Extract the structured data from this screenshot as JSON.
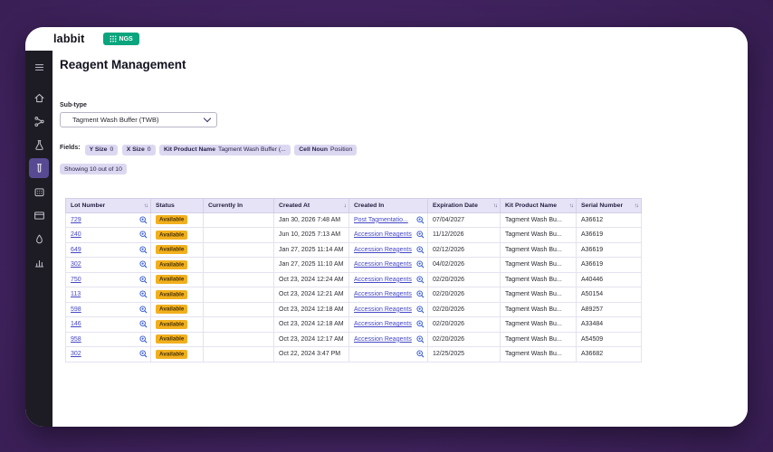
{
  "colors": {
    "teal": "#0aa57d",
    "chip_bg": "#dcd8f1",
    "link": "#4446c6",
    "status_bg": "#f2b01e",
    "status_text": "#4a3300",
    "header_bg": "#e7e3f7",
    "sidebar_bg": "#1d1c24",
    "sidebar_active": "#584a92",
    "zoom_icon": "#2f55d4"
  },
  "app": {
    "logo": "labbit",
    "badge_label": "NGS"
  },
  "sidebar": {
    "items": [
      {
        "name": "menu"
      },
      {
        "name": "home"
      },
      {
        "name": "workflow"
      },
      {
        "name": "flask"
      },
      {
        "name": "test-tube",
        "active": true
      },
      {
        "name": "plate"
      },
      {
        "name": "card"
      },
      {
        "name": "droplet"
      },
      {
        "name": "chart"
      }
    ]
  },
  "page": {
    "title": "Reagent Management",
    "subtype_label": "Sub-type",
    "subtype_value": "Tagment Wash Buffer (TWB)",
    "fields_label": "Fields:",
    "chips": [
      {
        "label": "Y Size",
        "value": "0"
      },
      {
        "label": "X Size",
        "value": "0"
      },
      {
        "label": "Kit Product Name",
        "value": "Tagment Wash Buffer (..."
      },
      {
        "label": "Cell Noun",
        "value": "Position"
      }
    ],
    "showing": "Showing 10 out of 10"
  },
  "table": {
    "columns": [
      {
        "label": "Lot Number",
        "sort": "both"
      },
      {
        "label": "Status",
        "sort": "none"
      },
      {
        "label": "Currently In",
        "sort": "none"
      },
      {
        "label": "Created At",
        "sort": "desc"
      },
      {
        "label": "Created In",
        "sort": "none"
      },
      {
        "label": "Expiration Date",
        "sort": "both"
      },
      {
        "label": "Kit Product Name",
        "sort": "both"
      },
      {
        "label": "Serial Number",
        "sort": "both"
      }
    ],
    "rows": [
      {
        "lot": "729",
        "status": "Available",
        "currently_in": "",
        "created_at": "Jan 30, 2026 7:48 AM",
        "created_in": "Post Tagmentatio...",
        "expiration_date": "07/04/2027",
        "kit_product_name": "Tagment Wash Bu...",
        "serial_number": "A36612"
      },
      {
        "lot": "240",
        "status": "Available",
        "currently_in": "",
        "created_at": "Jun 10, 2025 7:13 AM",
        "created_in": "Accession Reagents",
        "expiration_date": "11/12/2026",
        "kit_product_name": "Tagment Wash Bu...",
        "serial_number": "A36619"
      },
      {
        "lot": "649",
        "status": "Available",
        "currently_in": "",
        "created_at": "Jan 27, 2025 11:14 AM",
        "created_in": "Accession Reagents",
        "expiration_date": "02/12/2026",
        "kit_product_name": "Tagment Wash Bu...",
        "serial_number": "A36619"
      },
      {
        "lot": "302",
        "status": "Available",
        "currently_in": "",
        "created_at": "Jan 27, 2025 11:10 AM",
        "created_in": "Accession Reagents",
        "expiration_date": "04/02/2026",
        "kit_product_name": "Tagment Wash Bu...",
        "serial_number": "A36619"
      },
      {
        "lot": "750",
        "status": "Available",
        "currently_in": "",
        "created_at": "Oct 23, 2024 12:24 AM",
        "created_in": "Accession Reagents",
        "expiration_date": "02/20/2026",
        "kit_product_name": "Tagment Wash Bu...",
        "serial_number": "A40446"
      },
      {
        "lot": "113",
        "status": "Available",
        "currently_in": "",
        "created_at": "Oct 23, 2024 12:21 AM",
        "created_in": "Accession Reagents",
        "expiration_date": "02/20/2026",
        "kit_product_name": "Tagment Wash Bu...",
        "serial_number": "A50154"
      },
      {
        "lot": "598",
        "status": "Available",
        "currently_in": "",
        "created_at": "Oct 23, 2024 12:18 AM",
        "created_in": "Accession Reagents",
        "expiration_date": "02/20/2026",
        "kit_product_name": "Tagment Wash Bu...",
        "serial_number": "A89257"
      },
      {
        "lot": "146",
        "status": "Available",
        "currently_in": "",
        "created_at": "Oct 23, 2024 12:18 AM",
        "created_in": "Accession Reagents",
        "expiration_date": "02/20/2026",
        "kit_product_name": "Tagment Wash Bu...",
        "serial_number": "A33484"
      },
      {
        "lot": "958",
        "status": "Available",
        "currently_in": "",
        "created_at": "Oct 23, 2024 12:17 AM",
        "created_in": "Accession Reagents",
        "expiration_date": "02/20/2026",
        "kit_product_name": "Tagment Wash Bu...",
        "serial_number": "A54509"
      },
      {
        "lot": "302",
        "status": "Available",
        "currently_in": "",
        "created_at": "Oct 22, 2024 3:47 PM",
        "created_in": "",
        "expiration_date": "12/25/2025",
        "kit_product_name": "Tagment Wash Bu...",
        "serial_number": "A36682"
      }
    ]
  }
}
